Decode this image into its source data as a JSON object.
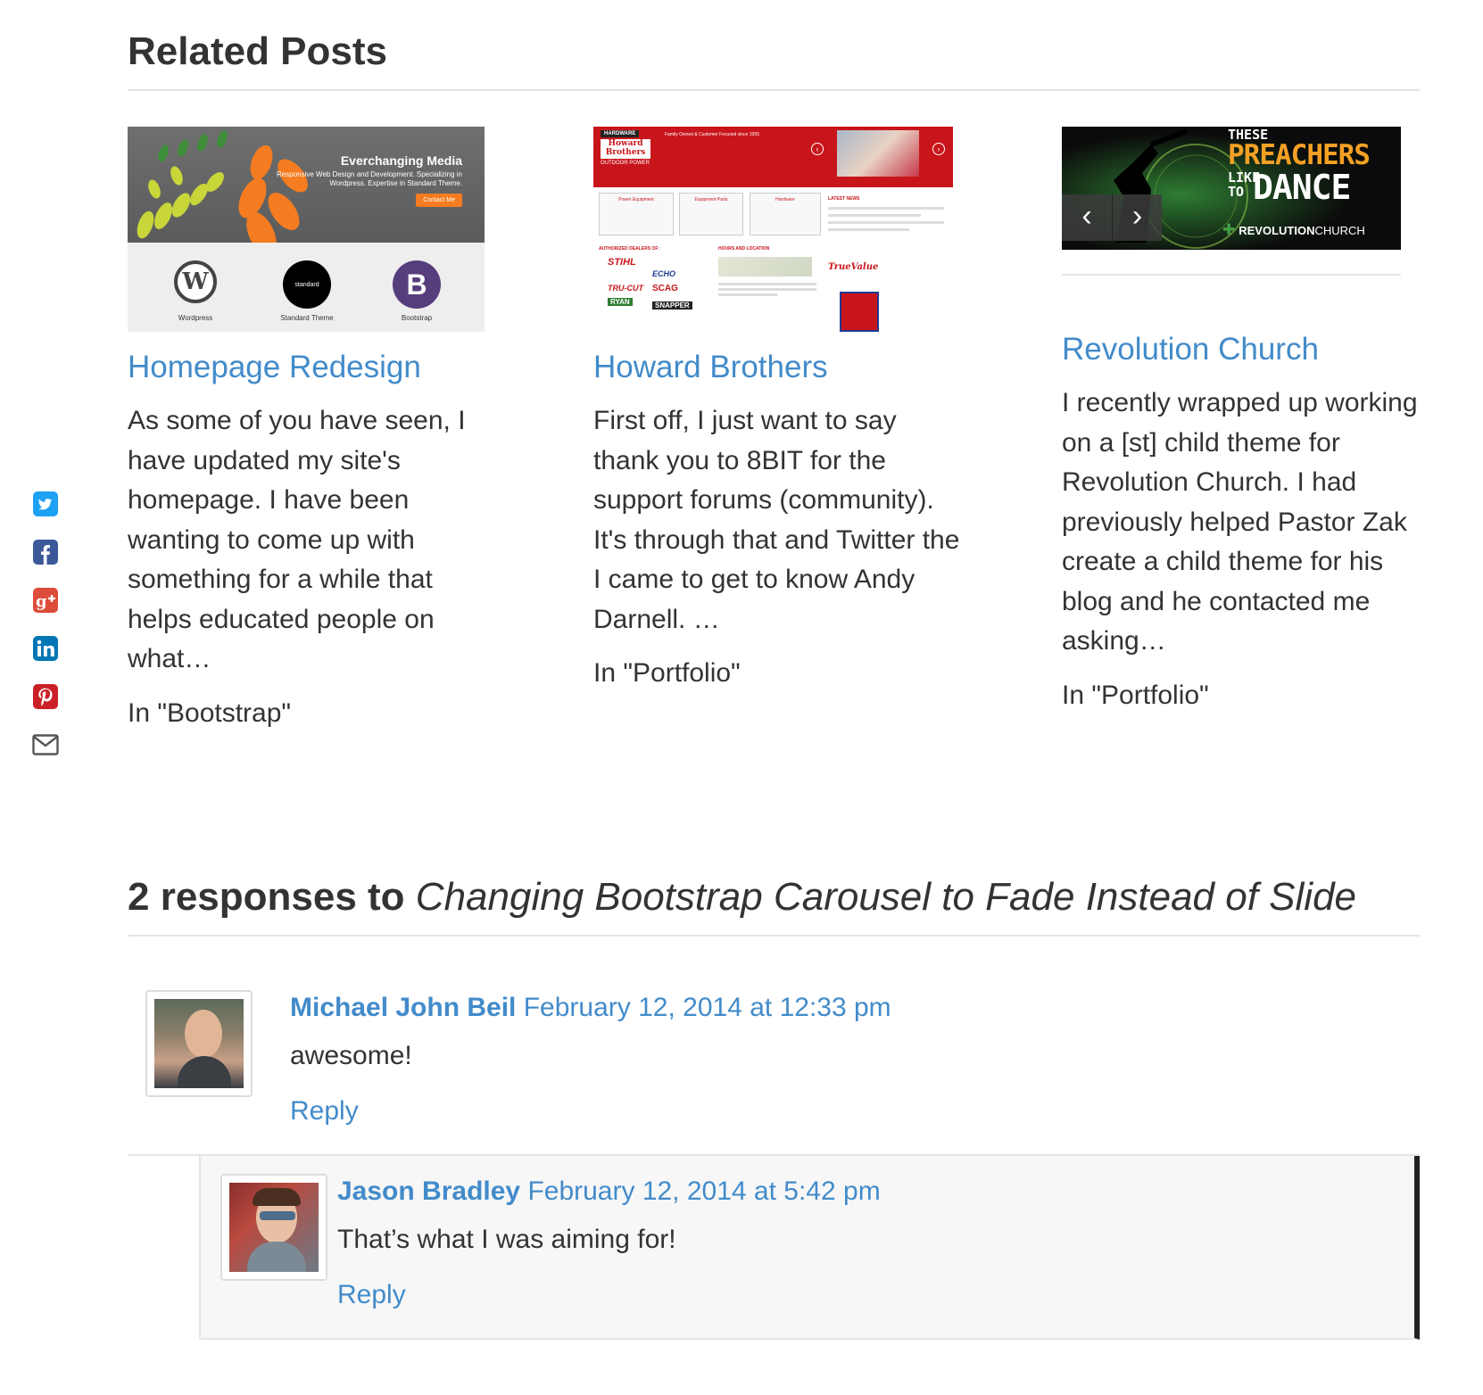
{
  "share": {
    "icons": [
      {
        "name": "twitter-icon",
        "color": "#1da1f2"
      },
      {
        "name": "facebook-icon",
        "color": "#3b5998"
      },
      {
        "name": "google-plus-icon",
        "color": "#dd4b39"
      },
      {
        "name": "linkedin-icon",
        "color": "#0077b5"
      },
      {
        "name": "pinterest-icon",
        "color": "#cb2027"
      },
      {
        "name": "email-icon",
        "color": "#555555"
      }
    ]
  },
  "related": {
    "heading": "Related Posts",
    "posts": [
      {
        "title": "Homepage Redesign",
        "excerpt": "As some of you have seen, I have updated my site's homepage. I have been wanting to come up with something for a while that helps educated people on what…",
        "category": "In \"Bootstrap\"",
        "thumb": {
          "banner_title": "Everchanging Media",
          "banner_text": "Responsive Web Design and Development. Specializing in Wordpress. Expertise in Standard Theme.",
          "button": "Contact Me",
          "logos": [
            "Wordpress",
            "Standard Theme",
            "Bootstrap"
          ],
          "logo_mid": "standard",
          "logo_right": "B"
        }
      },
      {
        "title": "Howard Brothers",
        "excerpt": "First off, I just want to say thank you to 8BIT for the support forums (community). It's through that and Twitter the I came to get to know Andy Darnell. …",
        "category": "In \"Portfolio\"",
        "thumb": {
          "top_label": "HARDWARE",
          "brand": "Howard Brothers",
          "sub_label": "OUTDOOR POWER",
          "tagline": "Family Owned & Customer Focused since 1955",
          "boxes": [
            "Power Equipment",
            "Equipment Parts",
            "Hardware"
          ],
          "news": "LATEST NEWS",
          "dealers": "AUTHORIZED DEALERS OF:",
          "hours": "HOURS AND LOCATION",
          "brands": [
            "STIHL",
            "ECHO",
            "SCAG",
            "TRU-CUT",
            "SNAPPER",
            "RYAN"
          ],
          "truevalue": "TrueValue"
        }
      },
      {
        "title": "Revolution Church",
        "excerpt": "I recently wrapped up working on a [st] child theme for Revolution Church. I had previously helped Pastor Zak create a child theme for his blog and he contacted me asking…",
        "category": "In \"Portfolio\"",
        "thumb": {
          "line1": "THESE",
          "line2": "PREACHERS",
          "line3a": "LIKE",
          "line3b": "TO",
          "line3c": "DANCE",
          "brand_bold": "REVOLUTION",
          "brand_light": "CHURCH",
          "prev": "‹",
          "next": "›"
        }
      }
    ]
  },
  "responses": {
    "count_label": "2 responses to",
    "post_title": "Changing Bootstrap Carousel to Fade Instead of Slide"
  },
  "comments": [
    {
      "author": "Michael John Beil",
      "date": "February 12, 2014 at 12:33 pm",
      "text": "awesome!",
      "reply": "Reply"
    },
    {
      "author": "Jason Bradley",
      "date": "February 12, 2014 at 5:42 pm",
      "text": "That’s what I was aiming for!",
      "reply": "Reply"
    }
  ]
}
